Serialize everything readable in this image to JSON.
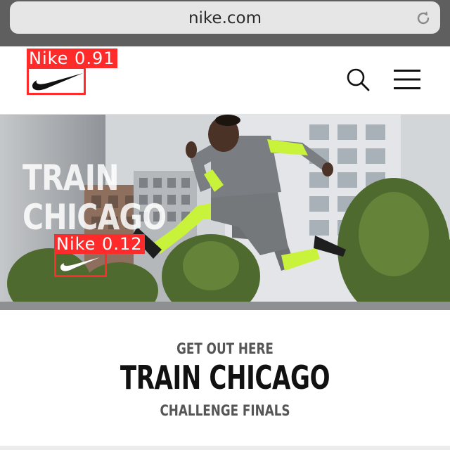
{
  "browser": {
    "url": "nike.com",
    "reload_icon": "reload-icon"
  },
  "header": {
    "logo_icon": "nike-swoosh-icon",
    "search_icon": "search-icon",
    "menu_icon": "hamburger-menu-icon"
  },
  "hero": {
    "title_line1": "TRAIN",
    "title_line2": "CHICAGO"
  },
  "detections": [
    {
      "label": "Nike 0.91",
      "color": "#ff2a2a"
    },
    {
      "label": "Nike 0.12",
      "color": "#ff2a2a"
    }
  ],
  "promo": {
    "kicker": "GET OUT HERE",
    "title": "TRAIN CHICAGO",
    "subtitle": "CHALLENGE FINALS"
  },
  "colors": {
    "browser_bar": "#5f5f5f",
    "neon_accent": "#c9f23b"
  }
}
